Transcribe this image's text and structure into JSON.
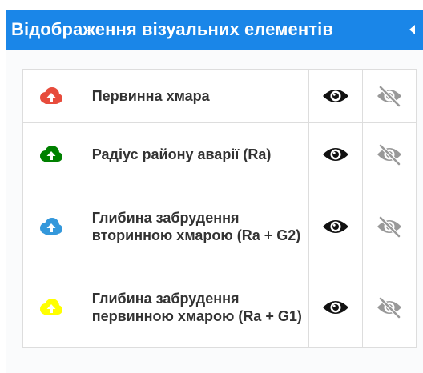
{
  "panel": {
    "title": "Відображення візуальних елементів",
    "collapse_icon": "chevron-left-icon",
    "header_color": "#1a86e8"
  },
  "layers": [
    {
      "label": "Первинна хмара",
      "icon": "cloud-upload-icon",
      "color": "#e74c3c"
    },
    {
      "label": "Радіус району аварії (Ra)",
      "icon": "cloud-upload-icon",
      "color": "#008000"
    },
    {
      "label": "Глибина забрудення вторинною хмарою (Ra + G2)",
      "icon": "cloud-upload-icon",
      "color": "#3498db"
    },
    {
      "label": "Глибина забрудення первинною хмарою (Ra + G1)",
      "icon": "cloud-upload-icon",
      "color": "#ffff00"
    }
  ],
  "actions": {
    "show_icon": "eye-icon",
    "hide_icon": "eye-slash-icon",
    "show_color": "#111111",
    "hide_color": "#999999"
  }
}
